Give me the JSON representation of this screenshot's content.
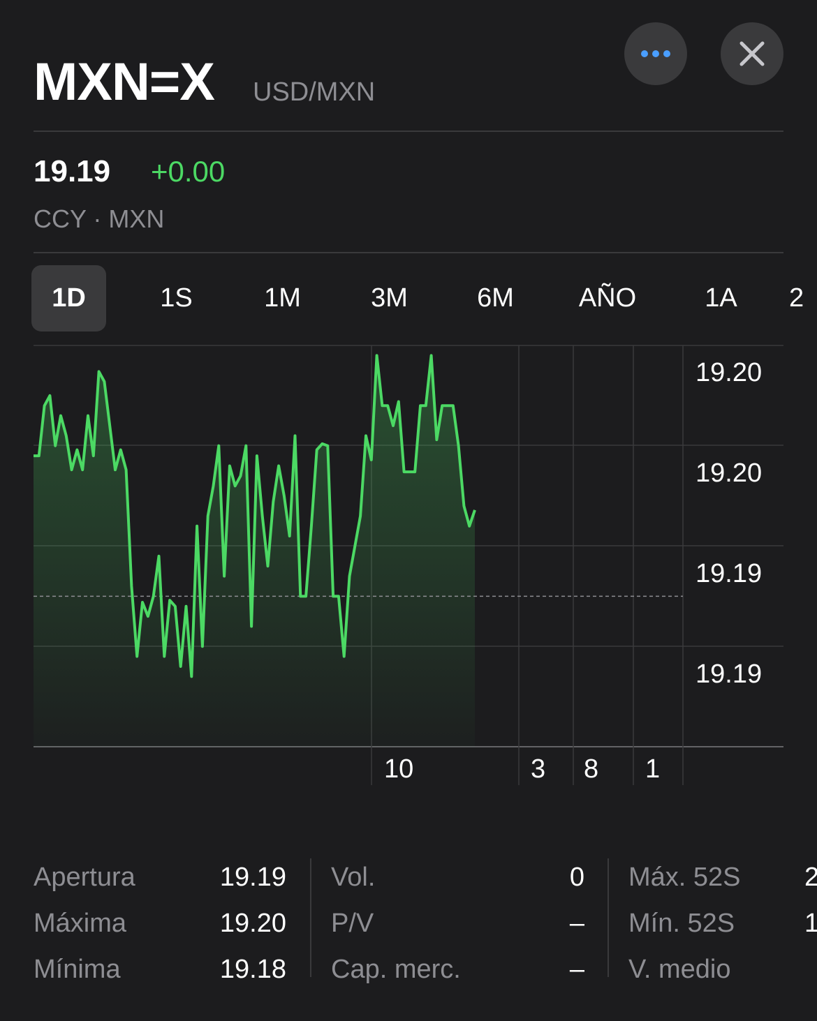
{
  "header": {
    "symbol": "MXN=X",
    "pair": "USD/MXN",
    "more_icon": "more-dots-icon",
    "close_icon": "close-x-icon"
  },
  "quote": {
    "price": "19.19",
    "change": "+0.00",
    "meta": "CCY · MXN"
  },
  "tabs": [
    {
      "label": "1D",
      "active": true
    },
    {
      "label": "1S",
      "active": false
    },
    {
      "label": "1M",
      "active": false
    },
    {
      "label": "3M",
      "active": false
    },
    {
      "label": "6M",
      "active": false
    },
    {
      "label": "AÑO",
      "active": false
    },
    {
      "label": "1A",
      "active": false
    },
    {
      "label": "2",
      "active": false
    }
  ],
  "colors": {
    "background": "#1c1c1e",
    "line": "#4cd964",
    "grid": "#3a3a3c",
    "muted": "#8e8e93"
  },
  "chart_data": {
    "type": "line",
    "y_ticks": [
      "19.20",
      "19.20",
      "19.19",
      "19.19"
    ],
    "x_ticks": [
      "10",
      "3",
      "8",
      "1"
    ],
    "ylim": [
      19.184,
      19.204
    ],
    "previous_close": 19.1915,
    "series": [
      {
        "values": [
          19.1985,
          19.1985,
          19.201,
          19.2015,
          19.199,
          19.2005,
          19.1995,
          19.1978,
          19.1988,
          19.1978,
          19.2005,
          19.1985,
          19.2027,
          19.2022,
          19.2,
          19.1978,
          19.1988,
          19.1978,
          19.192,
          19.1885,
          19.1912,
          19.1905,
          19.1915,
          19.1935,
          19.1885,
          19.1913,
          19.191,
          19.188,
          19.191,
          19.1875,
          19.195,
          19.189,
          19.1955,
          19.197,
          19.199,
          19.1925,
          19.198,
          19.197,
          19.1975,
          19.199,
          19.19,
          19.1985,
          19.1955,
          19.193,
          19.1962,
          19.198,
          19.1965,
          19.1945,
          19.1995,
          19.1915,
          19.1915,
          19.195,
          19.1988,
          19.1991,
          19.199,
          19.1915,
          19.1915,
          19.1885,
          19.1925,
          19.194,
          19.1955,
          19.1995,
          19.1983,
          19.2035,
          19.201,
          19.201,
          19.2,
          19.2012,
          19.1977,
          19.1977,
          19.1977,
          19.201,
          19.201,
          19.2035,
          19.1993,
          19.201,
          19.201,
          19.201,
          19.199,
          19.196,
          19.195,
          19.1958
        ]
      }
    ]
  },
  "stats": {
    "col1": [
      {
        "label": "Apertura",
        "value": "19.19"
      },
      {
        "label": "Máxima",
        "value": "19.20"
      },
      {
        "label": "Mínima",
        "value": "19.18"
      }
    ],
    "col2": [
      {
        "label": "Vol.",
        "value": "0"
      },
      {
        "label": "P/V",
        "value": "–"
      },
      {
        "label": "Cap. merc.",
        "value": "–"
      }
    ],
    "col3": [
      {
        "label": "Máx. 52S",
        "value": "2"
      },
      {
        "label": "Mín. 52S",
        "value": "1"
      },
      {
        "label": "V. medio",
        "value": ""
      }
    ]
  }
}
